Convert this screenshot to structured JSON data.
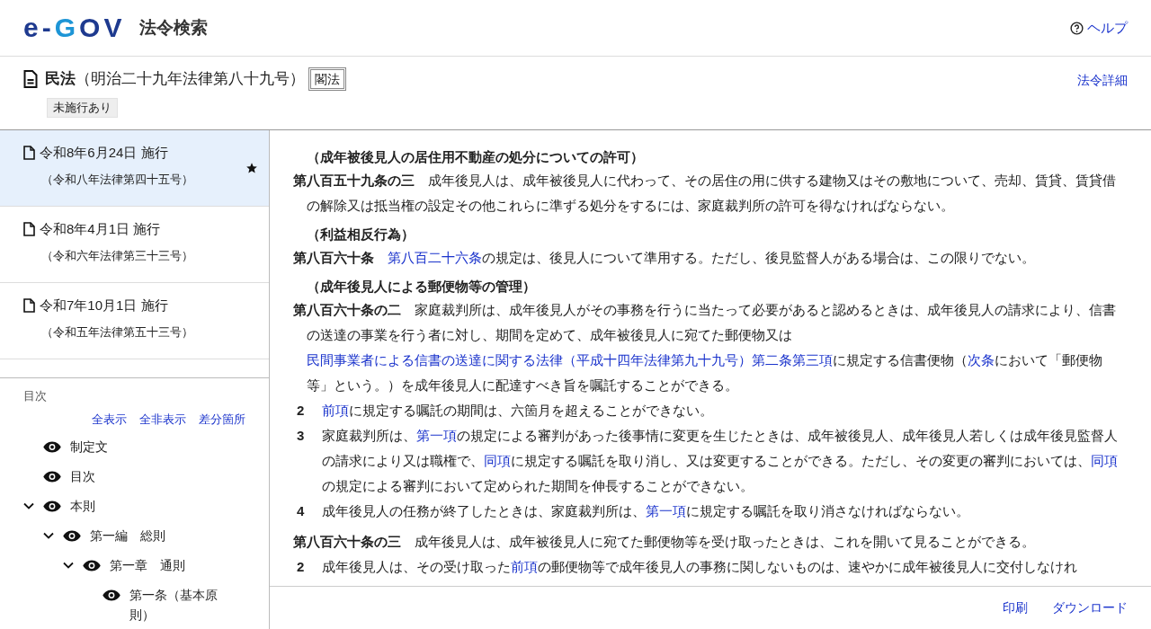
{
  "header": {
    "logo": "e-GOV",
    "service": "法令検索",
    "help": "ヘルプ"
  },
  "law": {
    "name": "民法",
    "number": "（明治二十九年法律第八十九号）",
    "badge": "閣法",
    "tag": "未施行あり",
    "details_link": "法令詳細"
  },
  "versions": [
    {
      "date": "令和8年6月24日 施行",
      "law": "（令和八年法律第四十五号）",
      "selected": true,
      "starred": true
    },
    {
      "date": "令和8年4月1日 施行",
      "law": "（令和六年法律第三十三号）",
      "selected": false,
      "starred": false
    },
    {
      "date": "令和7年10月1日 施行",
      "law": "（令和五年法律第五十三号）",
      "selected": false,
      "starred": false
    }
  ],
  "toc": {
    "title": "目次",
    "actions": [
      "全表示",
      "全非表示",
      "差分箇所"
    ],
    "items": [
      {
        "label": "制定文"
      },
      {
        "label": "目次"
      },
      {
        "label": "本則",
        "expanded": true,
        "children": [
          {
            "label": "第一編　総則",
            "expanded": true,
            "children": [
              {
                "label": "第一章　通則",
                "expanded": true,
                "children": [
                  {
                    "label": "第一条（基本原則）"
                  }
                ]
              }
            ]
          }
        ]
      }
    ]
  },
  "articles": [
    {
      "caption": "（成年被後見人の居住用不動産の処分についての許可）",
      "number": "第八百五十九条の三",
      "segments": [
        {
          "text": "成年後見人は、成年被後見人に代わって、その居住の用に供する建物又はその敷地について、売却、賃貸、賃貸借の解除又は抵当権の設定その他これらに準ずる処分をするには、家庭裁判所の許可を得なければならない。",
          "link": false
        }
      ]
    },
    {
      "caption": "（利益相反行為）",
      "number": "第八百六十条",
      "segments": [
        {
          "text": "第八百二十六条",
          "link": true
        },
        {
          "text": "の規定は、後見人について準用する。ただし、後見監督人がある場合は、この限りでない。",
          "link": false
        }
      ]
    },
    {
      "caption": "（成年後見人による郵便物等の管理）",
      "number": "第八百六十条の二",
      "segments": [
        {
          "text": "家庭裁判所は、成年後見人がその事務を行うに当たって必要があると認めるときは、成年後見人の請求により、信書の送達の事業を行う者に対し、期間を定めて、成年被後見人に宛てた郵便物又は",
          "link": false
        },
        {
          "text": "民間事業者による信書の送達に関する法律（平成十四年法律第九十九号）第二条第三項",
          "link": true
        },
        {
          "text": "に規定する信書便物（",
          "link": false
        },
        {
          "text": "次条",
          "link": true
        },
        {
          "text": "において「郵便物等」という。）を成年後見人に配達すべき旨を嘱託することができる。",
          "link": false
        }
      ],
      "paragraphs": [
        {
          "number": "2",
          "segments": [
            {
              "text": "前項",
              "link": true
            },
            {
              "text": "に規定する嘱託の期間は、六箇月を超えることができない。",
              "link": false
            }
          ]
        },
        {
          "number": "3",
          "segments": [
            {
              "text": "家庭裁判所は、",
              "link": false
            },
            {
              "text": "第一項",
              "link": true
            },
            {
              "text": "の規定による審判があった後事情に変更を生じたときは、成年被後見人、成年後見人若しくは成年後見監督人の請求により又は職権で、",
              "link": false
            },
            {
              "text": "同項",
              "link": true
            },
            {
              "text": "に規定する嘱託を取り消し、又は変更することができる。ただし、その変更の審判においては、",
              "link": false
            },
            {
              "text": "同項",
              "link": true
            },
            {
              "text": "の規定による審判において定められた期間を伸長することができない。",
              "link": false
            }
          ]
        },
        {
          "number": "4",
          "segments": [
            {
              "text": "成年後見人の任務が終了したときは、家庭裁判所は、",
              "link": false
            },
            {
              "text": "第一項",
              "link": true
            },
            {
              "text": "に規定する嘱託を取り消さなければならない。",
              "link": false
            }
          ]
        }
      ]
    },
    {
      "number": "第八百六十条の三",
      "segments": [
        {
          "text": "成年後見人は、成年被後見人に宛てた郵便物等を受け取ったときは、これを開いて見ることができる。",
          "link": false
        }
      ],
      "paragraphs": [
        {
          "number": "2",
          "segments": [
            {
              "text": "成年後見人は、その受け取った",
              "link": false
            },
            {
              "text": "前項",
              "link": true
            },
            {
              "text": "の郵便物等で成年後見人の事務に関しないものは、速やかに成年被後見人に交付しなけれ",
              "link": false
            }
          ]
        }
      ]
    }
  ],
  "footer": [
    "印刷",
    "ダウンロード"
  ]
}
